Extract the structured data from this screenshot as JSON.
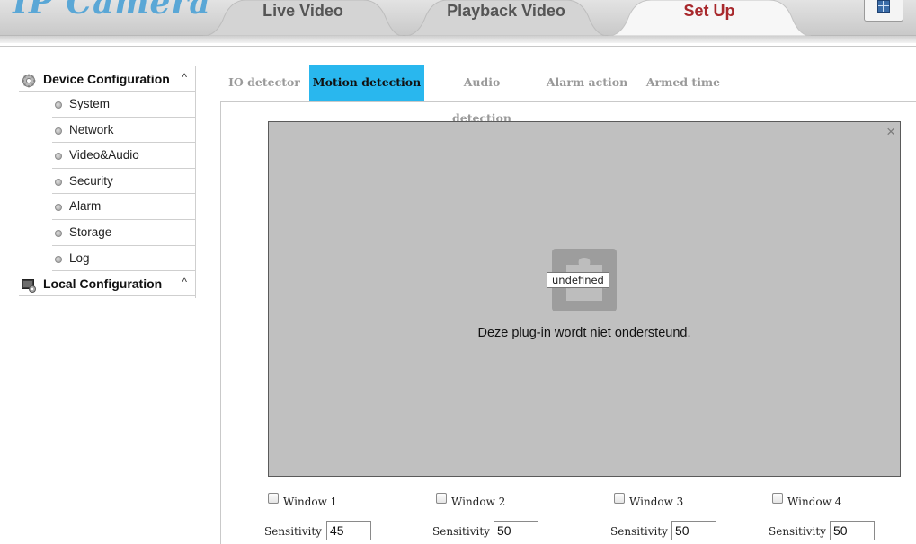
{
  "header": {
    "logo_text": "IP Camera",
    "tabs": [
      {
        "label": "Live Video"
      },
      {
        "label": "Playback Video"
      },
      {
        "label": "Set Up"
      }
    ],
    "active_tab": "Set Up"
  },
  "sidebar": {
    "device_config": {
      "title": "Device Configuration",
      "caret": "^",
      "items": [
        {
          "label": "System"
        },
        {
          "label": "Network"
        },
        {
          "label": "Video&Audio"
        },
        {
          "label": "Security"
        },
        {
          "label": "Alarm"
        },
        {
          "label": "Storage"
        },
        {
          "label": "Log"
        }
      ]
    },
    "local_config": {
      "title": "Local Configuration",
      "caret": "^"
    }
  },
  "subtabs": [
    {
      "label": "IO detector"
    },
    {
      "label": "Motion detection"
    },
    {
      "label": "Audio detection"
    },
    {
      "label": "Alarm action"
    },
    {
      "label": "Armed time"
    }
  ],
  "active_subtab": "Motion detection",
  "video": {
    "close": "×",
    "tooltip": "undefined",
    "message": "Deze plug-in wordt niet ondersteund."
  },
  "windows": [
    {
      "label": "Window 1",
      "checked": false,
      "sensitivity_label": "Sensitivity :",
      "sensitivity": "45"
    },
    {
      "label": "Window 2",
      "checked": false,
      "sensitivity_label": "Sensitivity :",
      "sensitivity": "50"
    },
    {
      "label": "Window 3",
      "checked": false,
      "sensitivity_label": "Sensitivity :",
      "sensitivity": "50"
    },
    {
      "label": "Window 4",
      "checked": false,
      "sensitivity_label": "Sensitivity :",
      "sensitivity": "50"
    }
  ],
  "colors": {
    "active_subtab_bg": "#29b7ee",
    "active_main_tab_text": "#a8282c",
    "logo": "#5aa7d6"
  },
  "icons": {
    "device_config": "gear-icon",
    "local_config": "monitor-icon",
    "plugin": "puzzle-piece-icon",
    "home": "window-icon",
    "close": "close-icon"
  }
}
